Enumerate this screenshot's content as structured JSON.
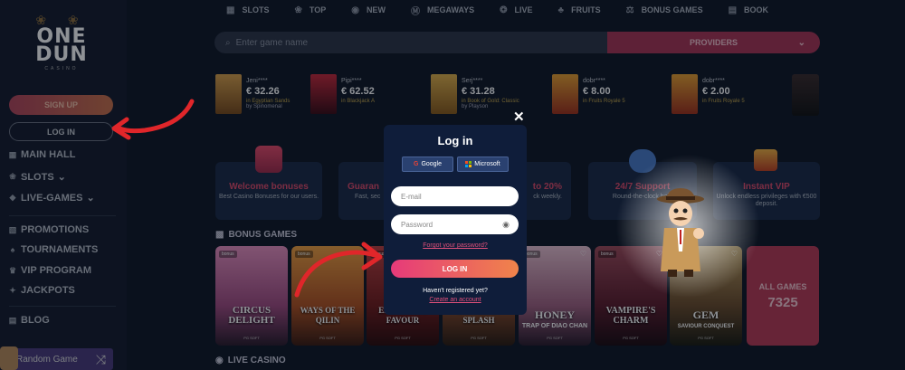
{
  "brand": {
    "line1": "ONE",
    "line2": "DUN",
    "sub": "CASINO",
    "antlers": "❀ ❀"
  },
  "sidebar": {
    "signup": "SIGN UP",
    "login": "LOG IN",
    "items": [
      {
        "label": "MAIN HALL",
        "icon": "hall-icon",
        "glyph": "▦"
      },
      {
        "label": "SLOTS",
        "icon": "cherries-icon",
        "glyph": "❀",
        "chev": "⌄"
      },
      {
        "label": "LIVE-GAMES",
        "icon": "chip-icon",
        "glyph": "◆",
        "chev": "⌄"
      },
      {
        "label": "PROMOTIONS",
        "icon": "gift-icon",
        "glyph": "▧"
      },
      {
        "label": "TOURNAMENTS",
        "icon": "cup-icon",
        "glyph": "♠"
      },
      {
        "label": "VIP PROGRAM",
        "icon": "crown-icon",
        "glyph": "♛"
      },
      {
        "label": "JACKPOTS",
        "icon": "coins-icon",
        "glyph": "✦"
      },
      {
        "label": "BLOG",
        "icon": "blog-icon",
        "glyph": "▤"
      }
    ],
    "random_game": "Random Game",
    "shuffle_glyph": "⤨"
  },
  "topnav": [
    {
      "label": "SLOTS",
      "glyph": "▦"
    },
    {
      "label": "TOP",
      "glyph": "❀"
    },
    {
      "label": "NEW",
      "glyph": "◉"
    },
    {
      "label": "MEGAWAYS",
      "glyph": "Ⓜ"
    },
    {
      "label": "LIVE",
      "glyph": "❂"
    },
    {
      "label": "FRUITS",
      "glyph": "♣"
    },
    {
      "label": "BONUS GAMES",
      "glyph": "⚖"
    },
    {
      "label": "BOOK",
      "glyph": "▤"
    }
  ],
  "search": {
    "placeholder": "Enter game name",
    "glyph": "⌕"
  },
  "providers": {
    "label": "PROVIDERS",
    "chev": "⌄"
  },
  "winners": [
    {
      "user": "Jeni****",
      "amount": "€ 32.26",
      "game": "in Egyptian Sands",
      "provider": "by Spinomenal"
    },
    {
      "user": "Pipi****",
      "amount": "€ 62.52",
      "game": "in Blackjack A",
      "provider": ""
    },
    {
      "user": "Serj****",
      "amount": "€ 31.28",
      "game": "in Book of Gold: Classic",
      "provider": "by Playson"
    },
    {
      "user": "dobr****",
      "amount": "€ 8.00",
      "game": "in Fruits Royale 5",
      "provider": ""
    },
    {
      "user": "dobr****",
      "amount": "€ 2.00",
      "game": "in Fruits Royale 5",
      "provider": ""
    }
  ],
  "promos": [
    {
      "title": "Welcome bonuses",
      "desc": "Best Casino Bonuses for our users."
    },
    {
      "title": "Guaran",
      "desc": "Fast, sec"
    },
    {
      "title": "to 20%",
      "desc": "ck weekly."
    },
    {
      "title": "24/7 Support",
      "desc": "Round-the-clock help"
    },
    {
      "title": "Instant VIP",
      "desc": "Unlock endless privileges with €500 deposit."
    }
  ],
  "sections": {
    "bonus_games": "BONUS GAMES",
    "live_casino": "LIVE CASINO"
  },
  "games": [
    {
      "tag": "bonus",
      "name": "CIRCUS DELIGHT",
      "sub": "",
      "provider": "PG SOFT"
    },
    {
      "tag": "bonus",
      "name": "WAYS OF THE QILIN",
      "sub": "",
      "provider": "PG SOFT"
    },
    {
      "tag": "bonus",
      "name": "EMPEROR'S FAVOUR",
      "sub": "",
      "provider": "PG SOFT"
    },
    {
      "tag": "bonus",
      "name": "DONGHAN SPLASH",
      "sub": "",
      "provider": "PG SOFT"
    },
    {
      "tag": "bonus",
      "name": "HONEY",
      "sub": "TRAP OF DIAO CHAN",
      "provider": "PG SOFT"
    },
    {
      "tag": "bonus",
      "name": "VAMPIRE'S CHARM",
      "sub": "",
      "provider": "PG SOFT"
    },
    {
      "tag": "bonus",
      "name": "GEM",
      "sub": "SAVIOUR CONQUEST",
      "provider": "PG SOFT"
    }
  ],
  "all_games": {
    "label": "ALL GAMES",
    "count": "7325"
  },
  "modal": {
    "title": "Log in",
    "close": "✕",
    "google": "Google",
    "microsoft": "Microsoft",
    "email_placeholder": "E-mail",
    "password_placeholder": "Password",
    "eye_glyph": "◉",
    "forgot": "Forgot your password?",
    "login": "LOG IN",
    "no_account": "Haven't registered yet?",
    "create": "Create an account"
  },
  "colors": {
    "accent": "#e63a7a",
    "background": "#0f1626",
    "modal": "#0f1d3a",
    "arrow": "#e0262a"
  }
}
